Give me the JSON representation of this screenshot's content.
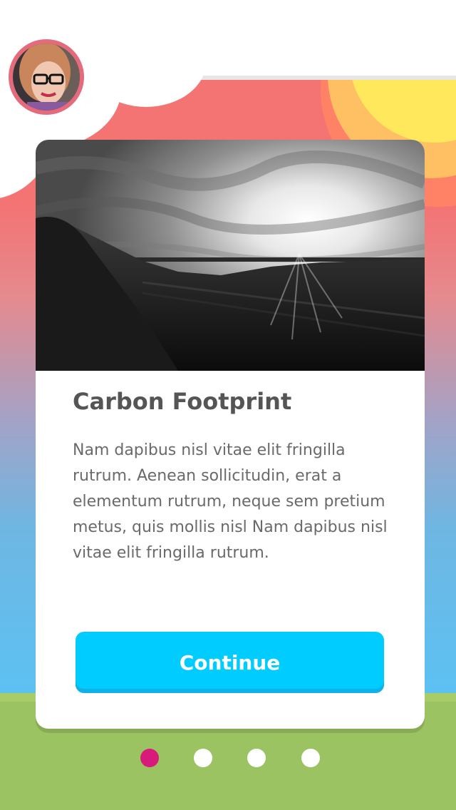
{
  "user": {
    "avatar_icon": "user-avatar"
  },
  "card": {
    "title": "Carbon Footprint",
    "body": "Nam dapibus nisl vitae elit fringilla rutrum. Aenean sollicitudin, erat a elementum rutrum, neque sem pretium metus, quis mollis nisl Nam dapibus nisl vitae elit fringilla rutrum.",
    "continue_label": "Continue"
  },
  "pagination": {
    "total": 4,
    "active_index": 0
  },
  "colors": {
    "sky_top": "#f47373",
    "sky_bottom": "#5bc2f3",
    "grass": "#9cc362",
    "sun": "#ffe85c",
    "button": "#00ccff",
    "active_dot": "#d81b7a"
  }
}
